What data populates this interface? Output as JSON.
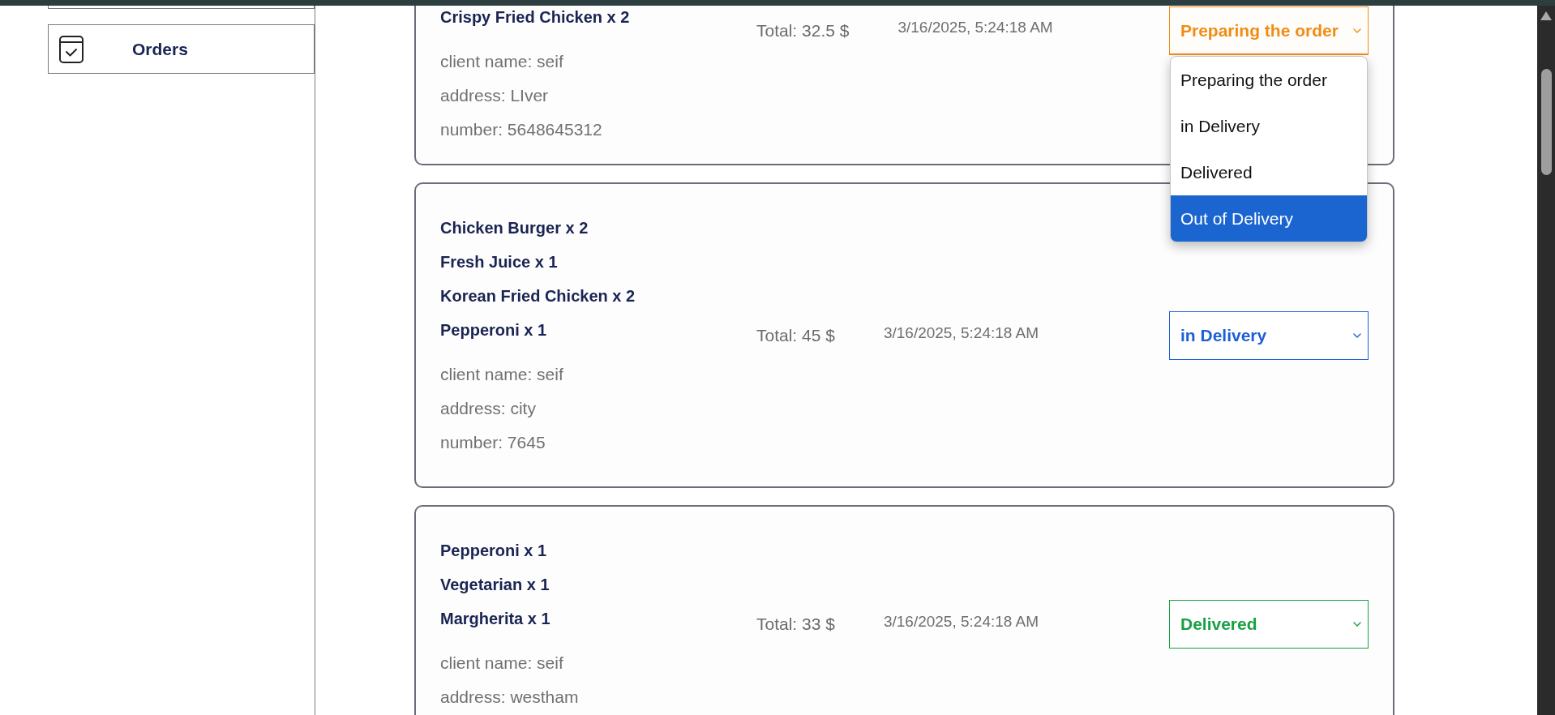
{
  "sidebar": {
    "items": [
      {
        "label": "Orders"
      }
    ]
  },
  "orders": [
    {
      "items": [
        "Crispy Fried Chicken x 2"
      ],
      "details": [
        "client name: seif",
        "address: LIver",
        "number: 5648645312"
      ],
      "total": "Total: 32.5 $",
      "date": "3/16/2025, 5:24:18 AM",
      "status": {
        "value": "Preparing the order",
        "color": "#f08c16",
        "open": true,
        "options": [
          {
            "label": "Preparing the order",
            "highlighted": false
          },
          {
            "label": "in Delivery",
            "highlighted": false
          },
          {
            "label": "Delivered",
            "highlighted": false
          },
          {
            "label": "Out of Delivery",
            "highlighted": true
          }
        ]
      }
    },
    {
      "items": [
        "Chicken Burger x 2",
        "Fresh Juice x 1",
        "Korean Fried Chicken x 2",
        "Pepperoni x 1"
      ],
      "details": [
        "client name: seif",
        "address: city",
        "number: 7645"
      ],
      "total": "Total: 45 $",
      "date": "3/16/2025, 5:24:18 AM",
      "status": {
        "value": "in Delivery",
        "color": "#1d5fd8",
        "open": false
      }
    },
    {
      "items": [
        "Pepperoni x 1",
        "Vegetarian x 1",
        "Margherita x 1"
      ],
      "details": [
        "client name: seif",
        "address: westham"
      ],
      "total": "Total: 33 $",
      "date": "3/16/2025, 5:24:18 AM",
      "status": {
        "value": "Delivered",
        "color": "#17a142",
        "open": false
      }
    }
  ]
}
